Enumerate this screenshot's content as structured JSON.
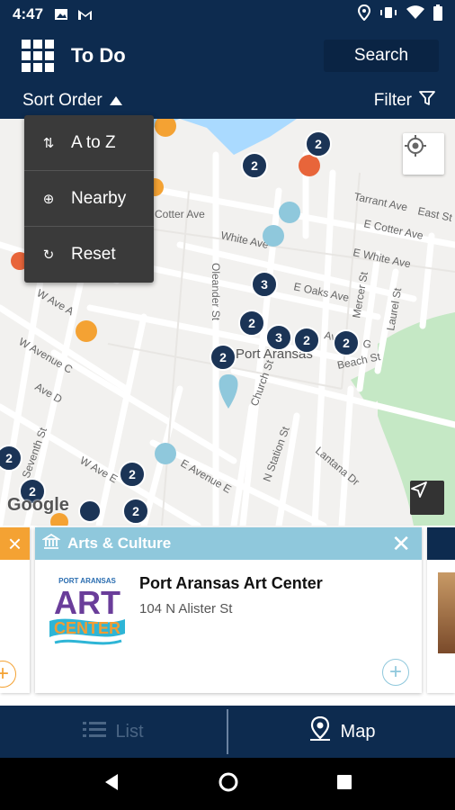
{
  "status_bar": {
    "time": "4:47"
  },
  "app_bar": {
    "title": "To Do",
    "search_label": "Search"
  },
  "sort_bar": {
    "sort_label": "Sort Order",
    "filter_label": "Filter"
  },
  "sort_menu": {
    "items": [
      {
        "label": "A to Z",
        "icon": "sort-az-icon"
      },
      {
        "label": "Nearby",
        "icon": "crosshair-icon"
      },
      {
        "label": "Reset",
        "icon": "refresh-icon"
      }
    ]
  },
  "map": {
    "town_label": "Port Aransas",
    "street_labels": [
      "Tarrant Ave",
      "East St",
      "E Cotter Ave",
      "White Ave",
      "E White Ave",
      "Oleander St",
      "E Oaks Ave",
      "Mercer St",
      "Laurel St",
      "Avenue G",
      "Beach St",
      "Church St",
      "W Avenue C",
      "Ave D",
      "W Ave E",
      "E Avenue E",
      "Seventh St",
      "N Station St",
      "Lantana Dr",
      "Cotter Ave",
      "W Ave A"
    ],
    "clusters": [
      "2",
      "2",
      "3",
      "2",
      "3",
      "2",
      "2",
      "2",
      "2",
      "2",
      "2",
      "2"
    ],
    "attribution": "Google"
  },
  "card": {
    "category": "Arts & Culture",
    "name": "Port Aransas Art Center",
    "address": "104 N Alister St",
    "logo_top_text": "PORT ARANSAS",
    "logo_art_text": "ART",
    "logo_center_text": "CENTER"
  },
  "tabs": {
    "list_label": "List",
    "map_label": "Map"
  },
  "colors": {
    "primary": "#0d2b4f",
    "arts_header": "#8fc8dc",
    "orange_accent": "#f4a233",
    "cluster": "#1b3456"
  }
}
